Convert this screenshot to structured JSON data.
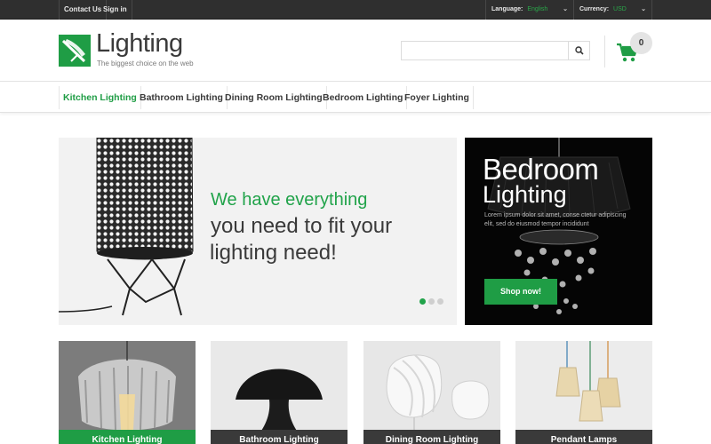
{
  "topbar": {
    "contact_label": "Contact Us",
    "signin_label": "Sign in",
    "language_label": "Language:",
    "language_value": "English",
    "currency_label": "Currency:",
    "currency_value": "USD"
  },
  "header": {
    "logo_title": "Lighting",
    "logo_tagline": "The biggest choice on the web",
    "search_placeholder": "",
    "search_icon": "search-icon",
    "cart_icon": "cart-icon",
    "cart_count": "0"
  },
  "nav": {
    "items": [
      {
        "label": "Kitchen Lighting",
        "active": true
      },
      {
        "label": "Bathroom Lighting",
        "active": false
      },
      {
        "label": "Dining Room Lighting",
        "active": false
      },
      {
        "label": "Bedroom Lighting",
        "active": false
      },
      {
        "label": "Foyer Lighting",
        "active": false
      }
    ]
  },
  "hero": {
    "line1": "We have everything",
    "line2": "you need to fit your",
    "line3": "lighting need!",
    "slide_count": 3,
    "active_slide": 1
  },
  "promo": {
    "title": "Bedroom",
    "subtitle": "Lighting",
    "description": "Lorem ipsum dolor sit amet, conse ctetur adipiscing elit, sed do eiusmod tempor incididunt",
    "button_label": "Shop now!"
  },
  "categories": [
    {
      "label": "Kitchen Lighting"
    },
    {
      "label": "Bathroom Lighting"
    },
    {
      "label": "Dining Room Lighting"
    },
    {
      "label": "Pendant Lamps"
    }
  ],
  "colors": {
    "accent": "#1f9d45",
    "topbar": "#2f2f2f",
    "text_dark": "#3a3a3a"
  }
}
